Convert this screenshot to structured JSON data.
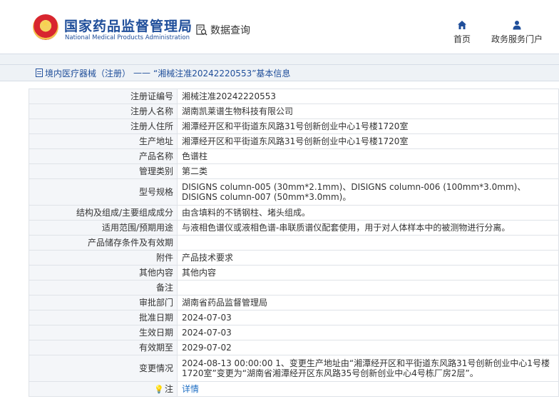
{
  "header": {
    "brand_cn": "国家药品监督管理局",
    "brand_en": "National Medical Products Administration",
    "data_query": "数据查询",
    "nav": [
      {
        "label": "首页",
        "icon": "home-icon"
      },
      {
        "label": "政务服务门户",
        "icon": "user-icon"
      }
    ]
  },
  "breadcrumb": {
    "category": "境内医疗器械（注册）",
    "separator": "——",
    "title": "“湘械注准20242220553”基本信息"
  },
  "fields": [
    {
      "label": "注册证编号",
      "value": "湘械注准20242220553"
    },
    {
      "label": "注册人名称",
      "value": "湖南凯莱谱生物科技有限公司"
    },
    {
      "label": "注册人住所",
      "value": "湘潭经开区和平街道东风路31号创新创业中心1号楼1720室"
    },
    {
      "label": "生产地址",
      "value": "湘潭经开区和平街道东风路31号创新创业中心1号楼1720室"
    },
    {
      "label": "产品名称",
      "value": "色谱柱"
    },
    {
      "label": "管理类别",
      "value": "第二类"
    },
    {
      "label": "型号规格",
      "value": "DISIGNS column-005 (30mm*2.1mm)、DISIGNS column-006 (100mm*3.0mm)、DISIGNS column-007 (50mm*3.0mm)。"
    },
    {
      "label": "结构及组成/主要组成成分",
      "value": "由含填料的不锈钢柱、堵头组成。"
    },
    {
      "label": "适用范围/预期用途",
      "value": "与液相色谱仪或液相色谱-串联质谱仪配套使用，用于对人体样本中的被测物进行分离。"
    },
    {
      "label": "产品储存条件及有效期",
      "value": ""
    },
    {
      "label": "附件",
      "value": "产品技术要求"
    },
    {
      "label": "其他内容",
      "value": "其他内容"
    },
    {
      "label": "备注",
      "value": ""
    },
    {
      "label": "审批部门",
      "value": "湖南省药品监督管理局"
    },
    {
      "label": "批准日期",
      "value": "2024-07-03"
    },
    {
      "label": "生效日期",
      "value": "2024-07-03"
    },
    {
      "label": "有效期至",
      "value": "2029-07-02"
    },
    {
      "label": "变更情况",
      "value": "2024-08-13 00:00:00 1、变更生产地址由“湘潭经开区和平街道东风路31号创新创业中心1号楼1720室”变更为“湖南省湘潭经开区东风路35号创新创业中心4号栋厂房2层”。"
    }
  ],
  "note": {
    "label": "注",
    "link": "详情"
  }
}
